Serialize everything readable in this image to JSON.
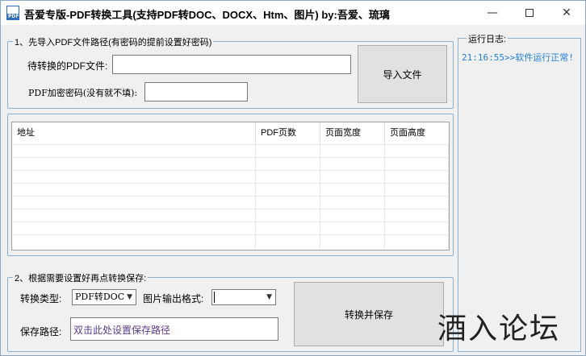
{
  "window": {
    "title": "吾爱专版-PDF转换工具(支持PDF转DOC、DOCX、Htm、图片) by:吾爱、琉璃",
    "icon_text": "PDF"
  },
  "import_group": {
    "legend": "1、先导入PDF文件路径(有密码的提前设置好密码)",
    "file_label": "待转换的PDF文件:",
    "file_value": "",
    "password_label": "PDF加密密码(没有就不填):",
    "password_value": "",
    "import_button": "导入文件"
  },
  "file_table": {
    "columns": [
      "地址",
      "PDF页数",
      "页面宽度",
      "页面高度"
    ],
    "rows": []
  },
  "save_group": {
    "legend": "2、根据需要设置好再点转换保存:",
    "type_label": "转换类型:",
    "type_selected": "PDF转DOC",
    "image_format_label": "图片输出格式:",
    "image_format_selected": "",
    "path_label": "保存路径:",
    "path_value": "双击此处设置保存路径",
    "convert_button": "转换并保存"
  },
  "log": {
    "legend": "运行日志:",
    "lines": [
      "21:16:55>>软件运行正常!"
    ]
  },
  "watermark": "酒入论坛",
  "colors": {
    "group_border": "#8ab0cf",
    "log_text": "#1e7fd6",
    "path_text": "#5b3a8a"
  }
}
